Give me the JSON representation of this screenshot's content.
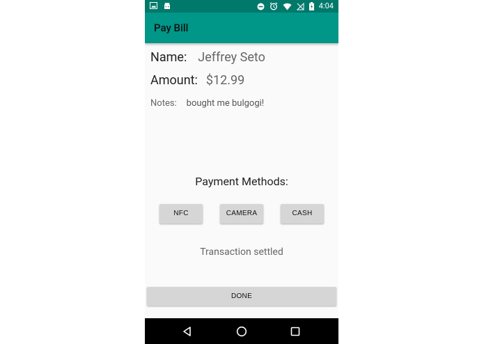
{
  "status_bar": {
    "time": "4:04",
    "battery_level": "100",
    "left_icons": [
      "image-icon",
      "android-icon"
    ],
    "right_icons": [
      "do-not-disturb-icon",
      "alarm-icon",
      "wifi-icon",
      "no-signal-icon",
      "battery-icon"
    ]
  },
  "app_bar": {
    "title": "Pay Bill"
  },
  "bill": {
    "name_label": "Name:",
    "name_value": "Jeffrey Seto",
    "amount_label": "Amount:",
    "amount_value": "$12.99",
    "notes_label": "Notes:",
    "notes_value": "bought me bulgogi!"
  },
  "payment": {
    "title": "Payment Methods:",
    "buttons": [
      "NFC",
      "CAMERA",
      "CASH"
    ]
  },
  "transaction_status": "Transaction settled",
  "done_label": "DONE",
  "nav_bar": {
    "icons": [
      "back-icon",
      "home-icon",
      "recents-icon"
    ]
  },
  "colors": {
    "status_bar": "#00796b",
    "app_bar": "#009688",
    "background": "#fafafa",
    "button": "#d6d6d6",
    "nav_bar": "#000000"
  }
}
